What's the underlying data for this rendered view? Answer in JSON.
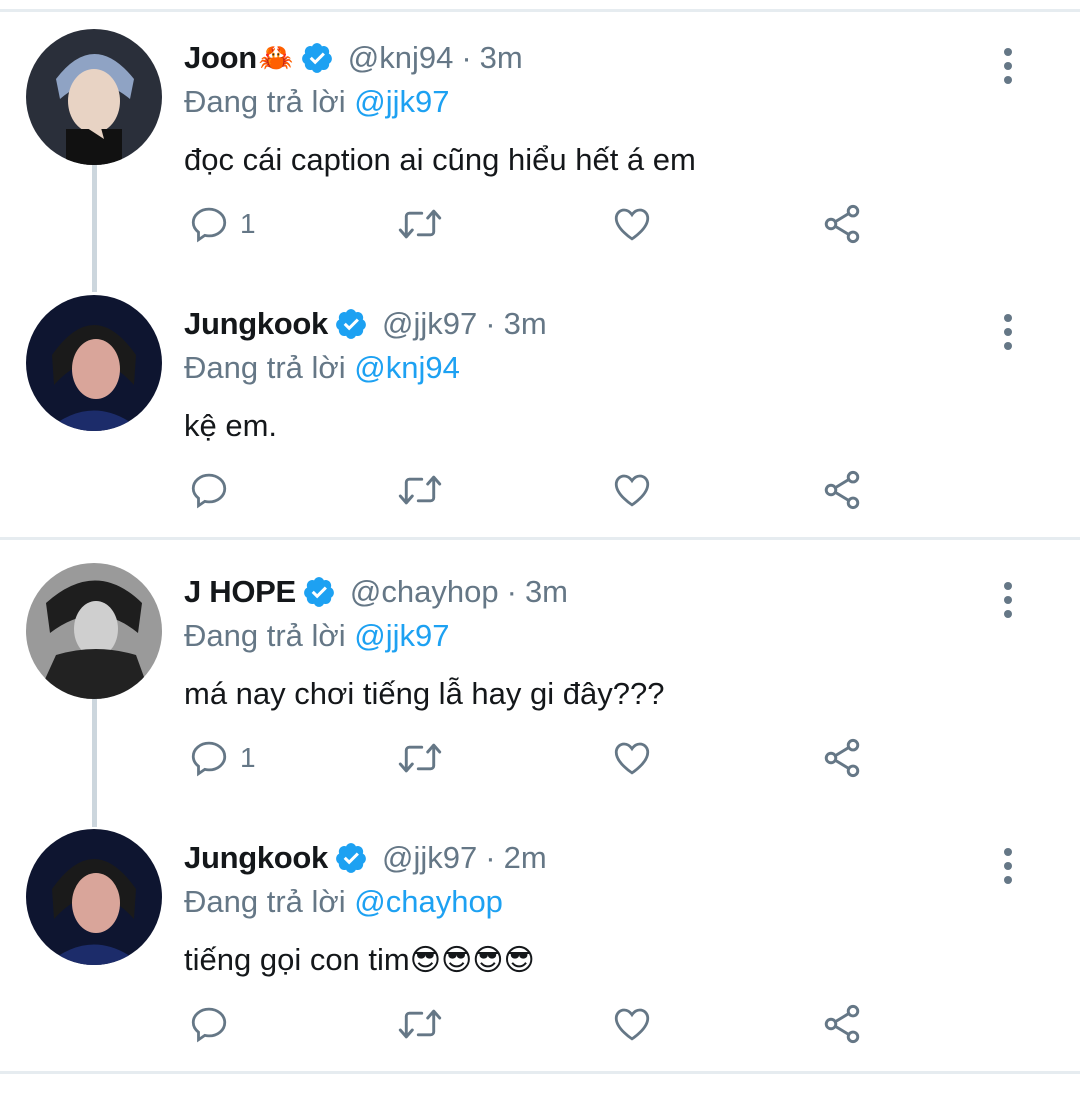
{
  "replying_label": "Đang trả lời",
  "tweets": [
    {
      "name": "Joon",
      "name_emoji": "🦀",
      "handle": "@knj94",
      "time": "3m",
      "replying_to": "@jjk97",
      "text": "đọc cái caption ai cũng hiểu hết á em",
      "reply_count": "1",
      "avatar_tone": "#6b7e9a"
    },
    {
      "name": "Jungkook",
      "name_emoji": "",
      "handle": "@jjk97",
      "time": "3m",
      "replying_to": "@knj94",
      "text": "kệ em.",
      "reply_count": "",
      "avatar_tone": "#1b2a55"
    },
    {
      "name": "J HOPE",
      "name_emoji": "",
      "handle": "@chayhop",
      "time": "3m",
      "replying_to": "@jjk97",
      "text": "má nay chơi tiếng lẫ hay gi đây???",
      "reply_count": "1",
      "avatar_tone": "#4a4a4a"
    },
    {
      "name": "Jungkook",
      "name_emoji": "",
      "handle": "@jjk97",
      "time": "2m",
      "replying_to": "@chayhop",
      "text": "tiếng gọi con tim",
      "text_emoji": "😎😎😎😎",
      "reply_count": "",
      "avatar_tone": "#1b2a55"
    }
  ],
  "colors": {
    "verified": "#1da1f2",
    "mention": "#1da1f2",
    "secondary_text": "#657786",
    "icon": "#657786"
  }
}
